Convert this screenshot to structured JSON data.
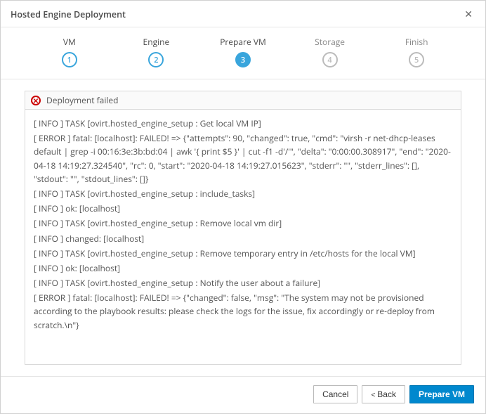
{
  "dialog": {
    "title": "Hosted Engine Deployment"
  },
  "wizard": {
    "steps": [
      {
        "label": "VM",
        "num": "1",
        "state": "done"
      },
      {
        "label": "Engine",
        "num": "2",
        "state": "done"
      },
      {
        "label": "Prepare VM",
        "num": "3",
        "state": "active"
      },
      {
        "label": "Storage",
        "num": "4",
        "state": "pending"
      },
      {
        "label": "Finish",
        "num": "5",
        "state": "pending"
      }
    ]
  },
  "status": {
    "text": "Deployment failed",
    "icon": "error"
  },
  "log": [
    "[ INFO ] TASK [ovirt.hosted_engine_setup : Get local VM IP]",
    "[ ERROR ] fatal: [localhost]: FAILED! => {\"attempts\": 90, \"changed\": true, \"cmd\": \"virsh -r net-dhcp-leases default | grep -i 00:16:3e:3b:bd:04 | awk '{ print $5 }' | cut -f1 -d'/'\", \"delta\": \"0:00:00.308917\", \"end\": \"2020-04-18 14:19:27.324540\", \"rc\": 0, \"start\": \"2020-04-18 14:19:27.015623\", \"stderr\": \"\", \"stderr_lines\": [], \"stdout\": \"\", \"stdout_lines\": []}",
    "[ INFO ] TASK [ovirt.hosted_engine_setup : include_tasks]",
    "[ INFO ] ok: [localhost]",
    "[ INFO ] TASK [ovirt.hosted_engine_setup : Remove local vm dir]",
    "[ INFO ] changed: [localhost]",
    "[ INFO ] TASK [ovirt.hosted_engine_setup : Remove temporary entry in /etc/hosts for the local VM]",
    "[ INFO ] ok: [localhost]",
    "[ INFO ] TASK [ovirt.hosted_engine_setup : Notify the user about a failure]",
    "[ ERROR ] fatal: [localhost]: FAILED! => {\"changed\": false, \"msg\": \"The system may not be provisioned according to the playbook results: please check the logs for the issue, fix accordingly or re-deploy from scratch.\\n\"}"
  ],
  "footer": {
    "cancel": "Cancel",
    "back": "Back",
    "primary": "Prepare VM"
  }
}
